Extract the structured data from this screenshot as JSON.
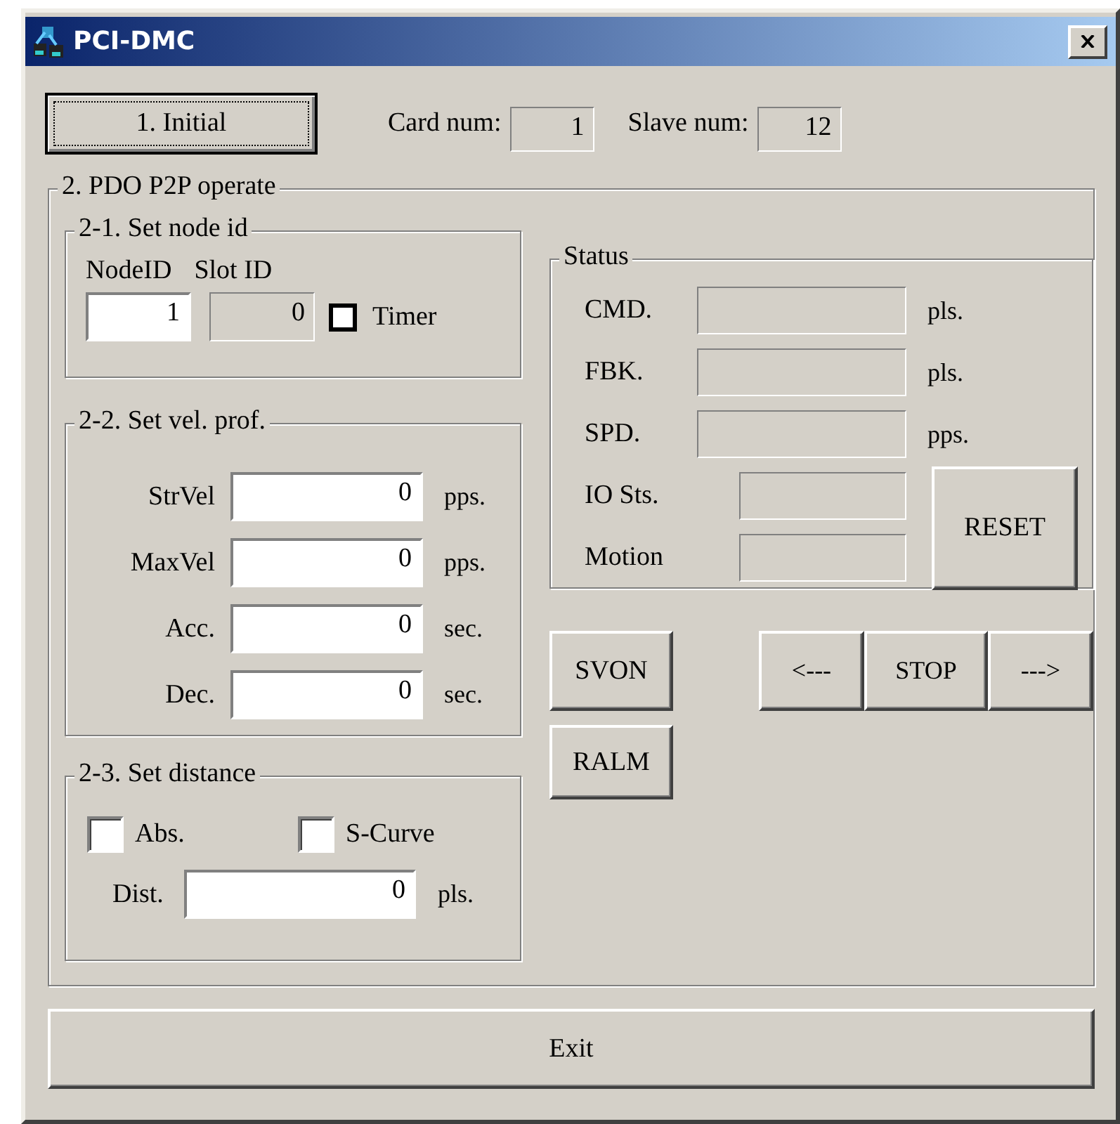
{
  "window": {
    "title": "PCI-DMC"
  },
  "initial_button": "1. Initial",
  "card_num": {
    "label": "Card num:",
    "value": "1"
  },
  "slave_num": {
    "label": "Slave num:",
    "value": "12"
  },
  "pdo_group": {
    "title": "2. PDO P2P operate"
  },
  "node_group": {
    "title": "2-1. Set node id",
    "node_id_label": "NodeID",
    "slot_id_label": "Slot ID",
    "node_id_value": "1",
    "slot_id_value": "0",
    "timer": {
      "label": "Timer",
      "checked": false
    }
  },
  "vel_group": {
    "title": "2-2. Set vel. prof.",
    "rows": [
      {
        "label": "StrVel",
        "value": "0",
        "unit": "pps."
      },
      {
        "label": "MaxVel",
        "value": "0",
        "unit": "pps."
      },
      {
        "label": "Acc.",
        "value": "0",
        "unit": "sec."
      },
      {
        "label": "Dec.",
        "value": "0",
        "unit": "sec."
      }
    ]
  },
  "dist_group": {
    "title": "2-3. Set distance",
    "checkboxes": [
      {
        "label": "Abs.",
        "checked": false
      },
      {
        "label": "S-Curve",
        "checked": false
      }
    ],
    "dist": {
      "label": "Dist.",
      "value": "0",
      "unit": "pls."
    }
  },
  "status_group": {
    "title": "Status",
    "rows": [
      {
        "label": "CMD.",
        "unit": "pls."
      },
      {
        "label": "FBK.",
        "unit": "pls."
      },
      {
        "label": "SPD.",
        "unit": "pps."
      }
    ],
    "short_rows": [
      {
        "label": "IO Sts."
      },
      {
        "label": "Motion"
      }
    ],
    "reset_button": "RESET"
  },
  "svon_button": "SVON",
  "jog_buttons": [
    "<---",
    "STOP",
    "--->"
  ],
  "ralm_button": "RALM",
  "exit_button": "Exit"
}
